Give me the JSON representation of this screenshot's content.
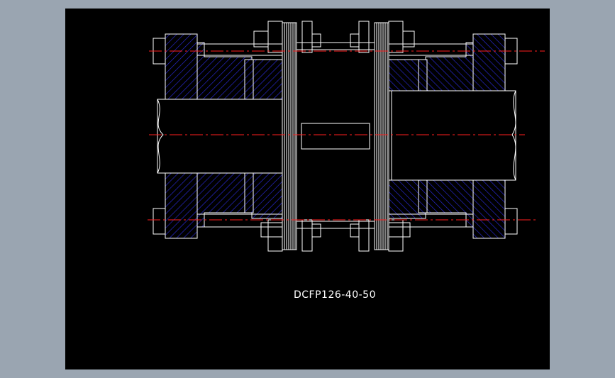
{
  "drawing": {
    "part_number": "DCFP126-40-50"
  },
  "colors": {
    "page_background": "#9aa5b1",
    "viewport_background": "#000000",
    "outline": "#ffffff",
    "hatch": "#2a2ad8",
    "centerline": "#ff1e1e"
  },
  "icons": {
    "bolts": "hex-bolt-shape",
    "shafts": "cylindrical-shaft-shape"
  }
}
